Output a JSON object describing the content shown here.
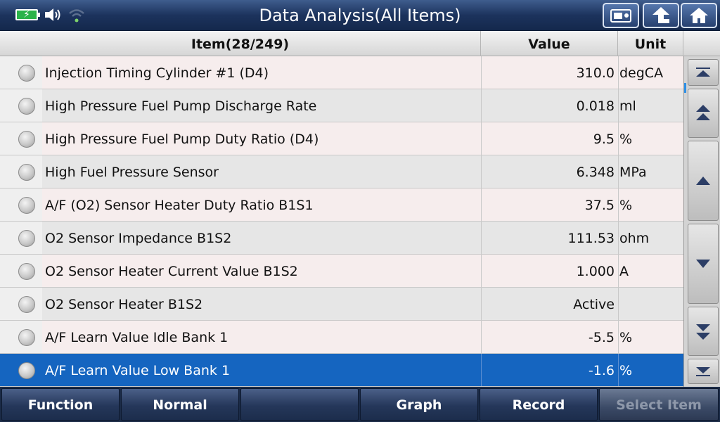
{
  "titlebar": {
    "title": "Data Analysis(All Items)",
    "status_icons": [
      "battery-charging-icon",
      "speaker-icon",
      "wifi-icon"
    ],
    "buttons": [
      "screenshot-icon",
      "back-icon",
      "home-icon"
    ]
  },
  "table": {
    "headers": {
      "item": "Item(28/249)",
      "value": "Value",
      "unit": "Unit"
    },
    "rows": [
      {
        "item": "Injection Timing Cylinder #1 (D4)",
        "value": "310.0",
        "unit": "degCA"
      },
      {
        "item": "High Pressure Fuel Pump Discharge Rate",
        "value": "0.018",
        "unit": "ml"
      },
      {
        "item": "High Pressure Fuel Pump Duty Ratio (D4)",
        "value": "9.5",
        "unit": "%"
      },
      {
        "item": "High Fuel Pressure Sensor",
        "value": "6.348",
        "unit": "MPa"
      },
      {
        "item": "A/F (O2) Sensor Heater Duty Ratio B1S1",
        "value": "37.5",
        "unit": "%"
      },
      {
        "item": "O2 Sensor Impedance B1S2",
        "value": "111.53",
        "unit": "ohm"
      },
      {
        "item": "O2 Sensor Heater Current Value B1S2",
        "value": "1.000",
        "unit": "A"
      },
      {
        "item": "O2 Sensor Heater B1S2",
        "value": "Active",
        "unit": ""
      },
      {
        "item": "A/F Learn Value Idle Bank 1",
        "value": "-5.5",
        "unit": "%"
      },
      {
        "item": "A/F Learn Value Low Bank 1",
        "value": "-1.6",
        "unit": "%"
      }
    ],
    "selected_index": 9
  },
  "scroll": {
    "buttons": [
      "scroll-top-icon",
      "page-up-icon",
      "line-up-icon",
      "line-down-icon",
      "page-down-icon",
      "scroll-bottom-icon"
    ]
  },
  "toolbar": {
    "function_label": "Function",
    "normal_label": "Normal",
    "empty_label": "",
    "graph_label": "Graph",
    "record_label": "Record",
    "select_item_label": "Select Item"
  },
  "colors": {
    "titlebar": "#1c335d",
    "selected_row": "#1565c0",
    "toolbar": "#25375a"
  }
}
